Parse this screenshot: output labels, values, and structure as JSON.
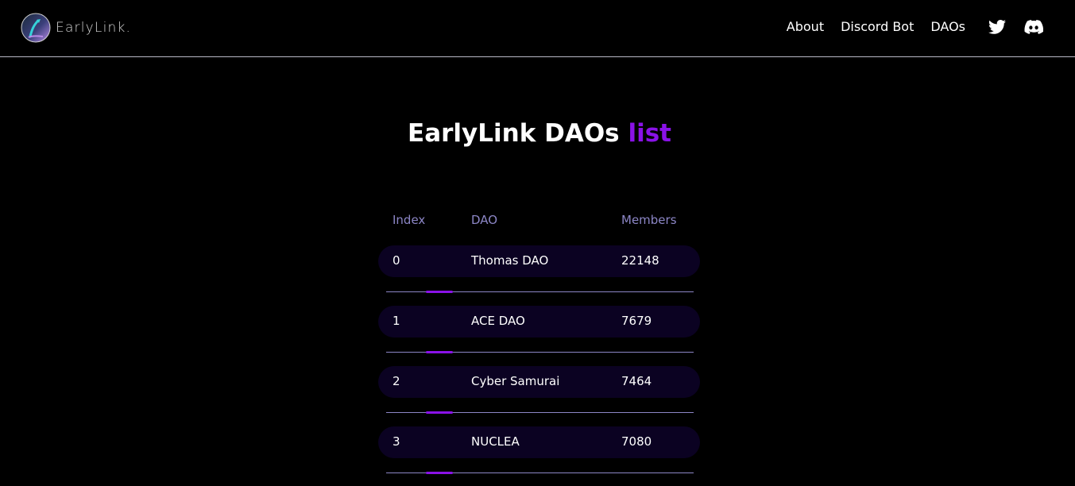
{
  "brand": {
    "name": "EarlyLink."
  },
  "nav": {
    "about": "About",
    "discord_bot": "Discord Bot",
    "daos": "DAOs",
    "twitter_icon": "twitter-icon",
    "discord_icon": "discord-icon"
  },
  "page": {
    "title_main": "EarlyLink DAOs",
    "title_accent": "list"
  },
  "colors": {
    "background": "#000000",
    "accent": "#8a12e8",
    "row_background": "#0b0222",
    "header_text": "#8c86c6"
  },
  "table": {
    "headers": {
      "index": "Index",
      "dao": "DAO",
      "members": "Members"
    },
    "rows": [
      {
        "index": "0",
        "dao": "Thomas DAO",
        "members": "22148"
      },
      {
        "index": "1",
        "dao": "ACE DAO",
        "members": "7679"
      },
      {
        "index": "2",
        "dao": "Cyber Samurai",
        "members": "7464"
      },
      {
        "index": "3",
        "dao": "NUCLEA",
        "members": "7080"
      }
    ]
  }
}
